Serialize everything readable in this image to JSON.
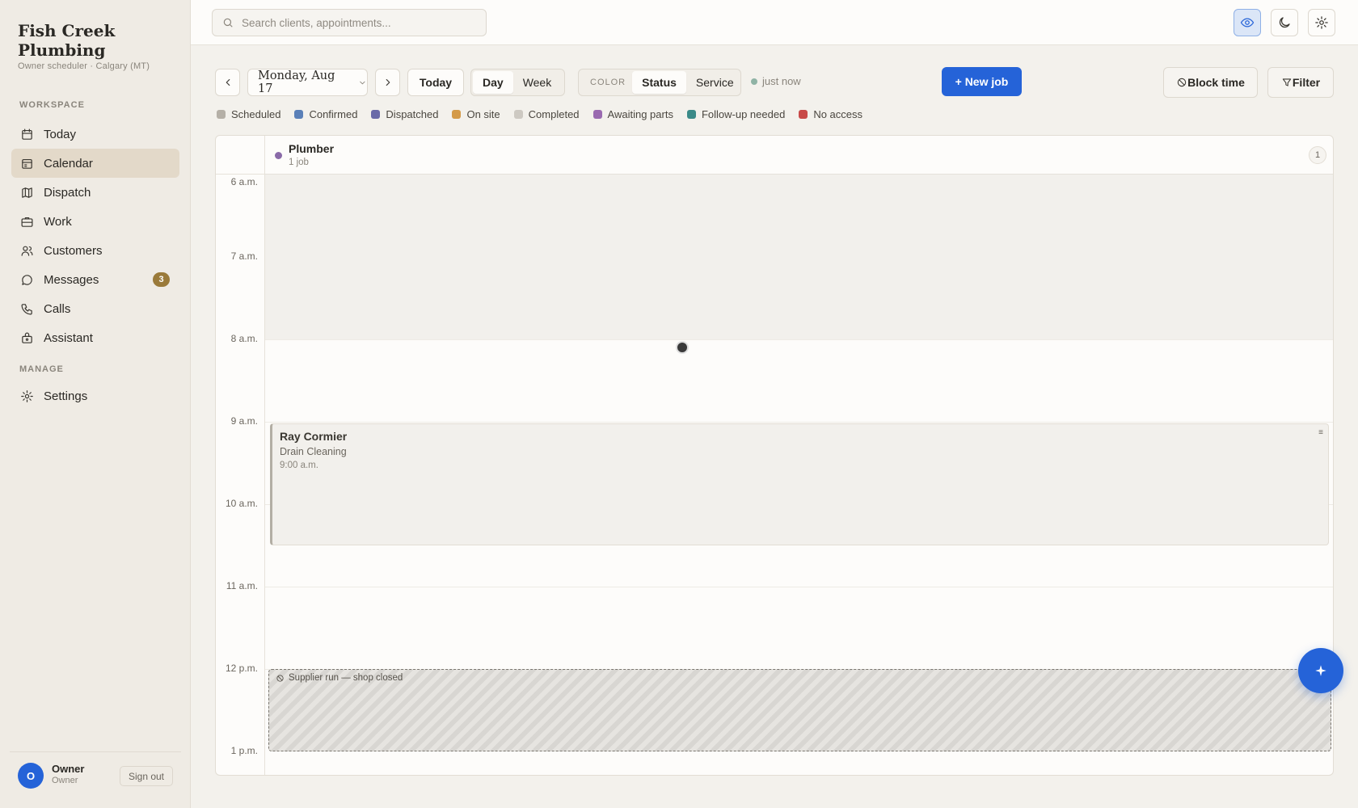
{
  "sidebar": {
    "brand": "Fish Creek Plumbing",
    "subtitle": "Owner scheduler · Calgary (MT)",
    "workspace_label": "WORKSPACE",
    "manage_label": "MANAGE",
    "items": [
      {
        "label": "Today",
        "icon": "calendar-icon"
      },
      {
        "label": "Calendar",
        "icon": "calendar-grid-icon",
        "active": true
      },
      {
        "label": "Dispatch",
        "icon": "map-icon"
      },
      {
        "label": "Work",
        "icon": "briefcase-icon"
      },
      {
        "label": "Customers",
        "icon": "users-icon"
      },
      {
        "label": "Messages",
        "icon": "chat-icon",
        "badge": "3"
      },
      {
        "label": "Calls",
        "icon": "phone-icon"
      },
      {
        "label": "Assistant",
        "icon": "bot-icon"
      }
    ],
    "manage_items": [
      {
        "label": "Settings",
        "icon": "gear-icon"
      }
    ],
    "user": {
      "initial": "O",
      "name": "Owner",
      "role": "Owner",
      "signout": "Sign out"
    }
  },
  "topbar": {
    "search_placeholder": "Search clients, appointments...",
    "icons": [
      "eye-icon",
      "moon-icon",
      "gear-icon"
    ]
  },
  "toolbar": {
    "date": "Monday, Aug 17",
    "today": "Today",
    "views": [
      "Day",
      "Week"
    ],
    "active_view": "Day",
    "color_label": "COLOR",
    "color_modes": [
      "Status",
      "Service"
    ],
    "active_color_mode": "Status",
    "freshness": "just now",
    "new_job": "+ New job",
    "block_time": "Block time",
    "filter": "Filter"
  },
  "legend": [
    {
      "label": "Scheduled",
      "color": "#b5b0a7"
    },
    {
      "label": "Confirmed",
      "color": "#5a80b8"
    },
    {
      "label": "Dispatched",
      "color": "#6a6aa8"
    },
    {
      "label": "On site",
      "color": "#d49a48"
    },
    {
      "label": "Completed",
      "color": "#cdc9c2"
    },
    {
      "label": "Awaiting parts",
      "color": "#9a6ab0"
    },
    {
      "label": "Follow-up needed",
      "color": "#3a8a88"
    },
    {
      "label": "No access",
      "color": "#c84a48"
    }
  ],
  "calendar": {
    "column": {
      "title": "Plumber",
      "subtitle": "1 job",
      "count": "1",
      "color": "#8a6aa8"
    },
    "hours": [
      "6 a.m.",
      "7 a.m.",
      "8 a.m.",
      "9 a.m.",
      "10 a.m.",
      "11 a.m.",
      "12 p.m.",
      "1 p.m."
    ],
    "job": {
      "client": "Ray Cormier",
      "service": "Drain Cleaning",
      "time": "9:00 a.m."
    },
    "blocked": {
      "label": "Supplier run — shop closed"
    }
  }
}
